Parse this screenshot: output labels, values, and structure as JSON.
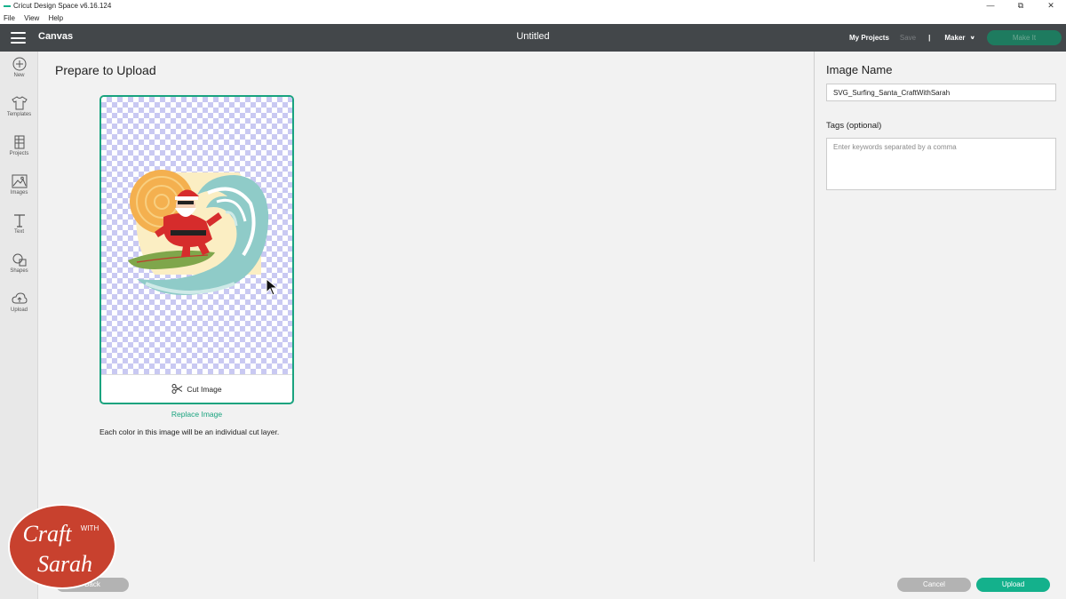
{
  "window": {
    "title": "Cricut Design Space  v6.16.124",
    "controls": [
      "—",
      "⧉",
      "✕"
    ]
  },
  "menu": {
    "items": [
      "File",
      "View",
      "Help"
    ]
  },
  "header": {
    "app_name": "Canvas",
    "doc_title": "Untitled",
    "my_projects": "My Projects",
    "save": "Save",
    "separator": "|",
    "machine": "Maker",
    "make_it": "Make It"
  },
  "sidebar": {
    "items": [
      {
        "label": "New",
        "icon": "plus-circle-icon"
      },
      {
        "label": "Templates",
        "icon": "shirt-icon"
      },
      {
        "label": "Projects",
        "icon": "projects-icon"
      },
      {
        "label": "Images",
        "icon": "image-icon"
      },
      {
        "label": "Text",
        "icon": "text-icon"
      },
      {
        "label": "Shapes",
        "icon": "shapes-icon"
      },
      {
        "label": "Upload",
        "icon": "upload-cloud-icon"
      }
    ]
  },
  "main": {
    "title": "Prepare to Upload",
    "cut_image_label": "Cut Image",
    "replace_link": "Replace Image",
    "info": "Each color in this image will be an individual cut layer."
  },
  "right_panel": {
    "image_name_title": "Image Name",
    "image_name_value": "SVG_Surfing_Santa_CraftWithSarah",
    "tags_label": "Tags (optional)",
    "tags_placeholder": "Enter keywords separated by a comma"
  },
  "footer": {
    "back": "Back",
    "cancel": "Cancel",
    "upload": "Upload"
  },
  "watermark": {
    "line1": "Craft",
    "line2": "WITH",
    "line3": "Sarah"
  },
  "colors": {
    "accent": "#14b18c",
    "header_bg": "#43474a",
    "watermark_bg": "#c8412e"
  }
}
